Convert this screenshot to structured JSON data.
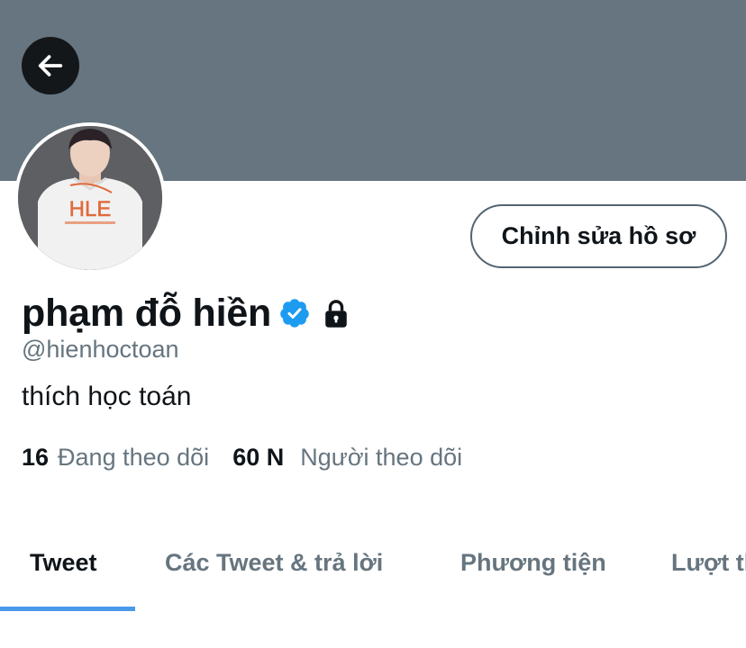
{
  "header": {
    "back_icon": "arrow-left-icon",
    "banner_color": "#66757f"
  },
  "profile": {
    "display_name": "phạm đỗ hiền",
    "handle": "@hienhoctoan",
    "bio": "thích học toán",
    "verified_icon": "verified-badge-icon",
    "protected_icon": "lock-icon",
    "avatar_image": "profile-photo",
    "avatar_shirt_text": "HLE",
    "edit_button_label": "Chỉnh sửa hồ sơ"
  },
  "stats": {
    "following_count": "16",
    "following_label": "Đang theo dõi",
    "followers_count": "60 N",
    "followers_label": "Người theo dõi"
  },
  "tabs": [
    {
      "label": "Tweet",
      "active": true
    },
    {
      "label": "Các Tweet & trả lời",
      "active": false
    },
    {
      "label": "Phương tiện",
      "active": false
    },
    {
      "label": "Lượt thích",
      "active": false
    }
  ],
  "colors": {
    "accent": "#4a99e9",
    "verified": "#1d9bf0",
    "secondary_text": "#66757f"
  }
}
